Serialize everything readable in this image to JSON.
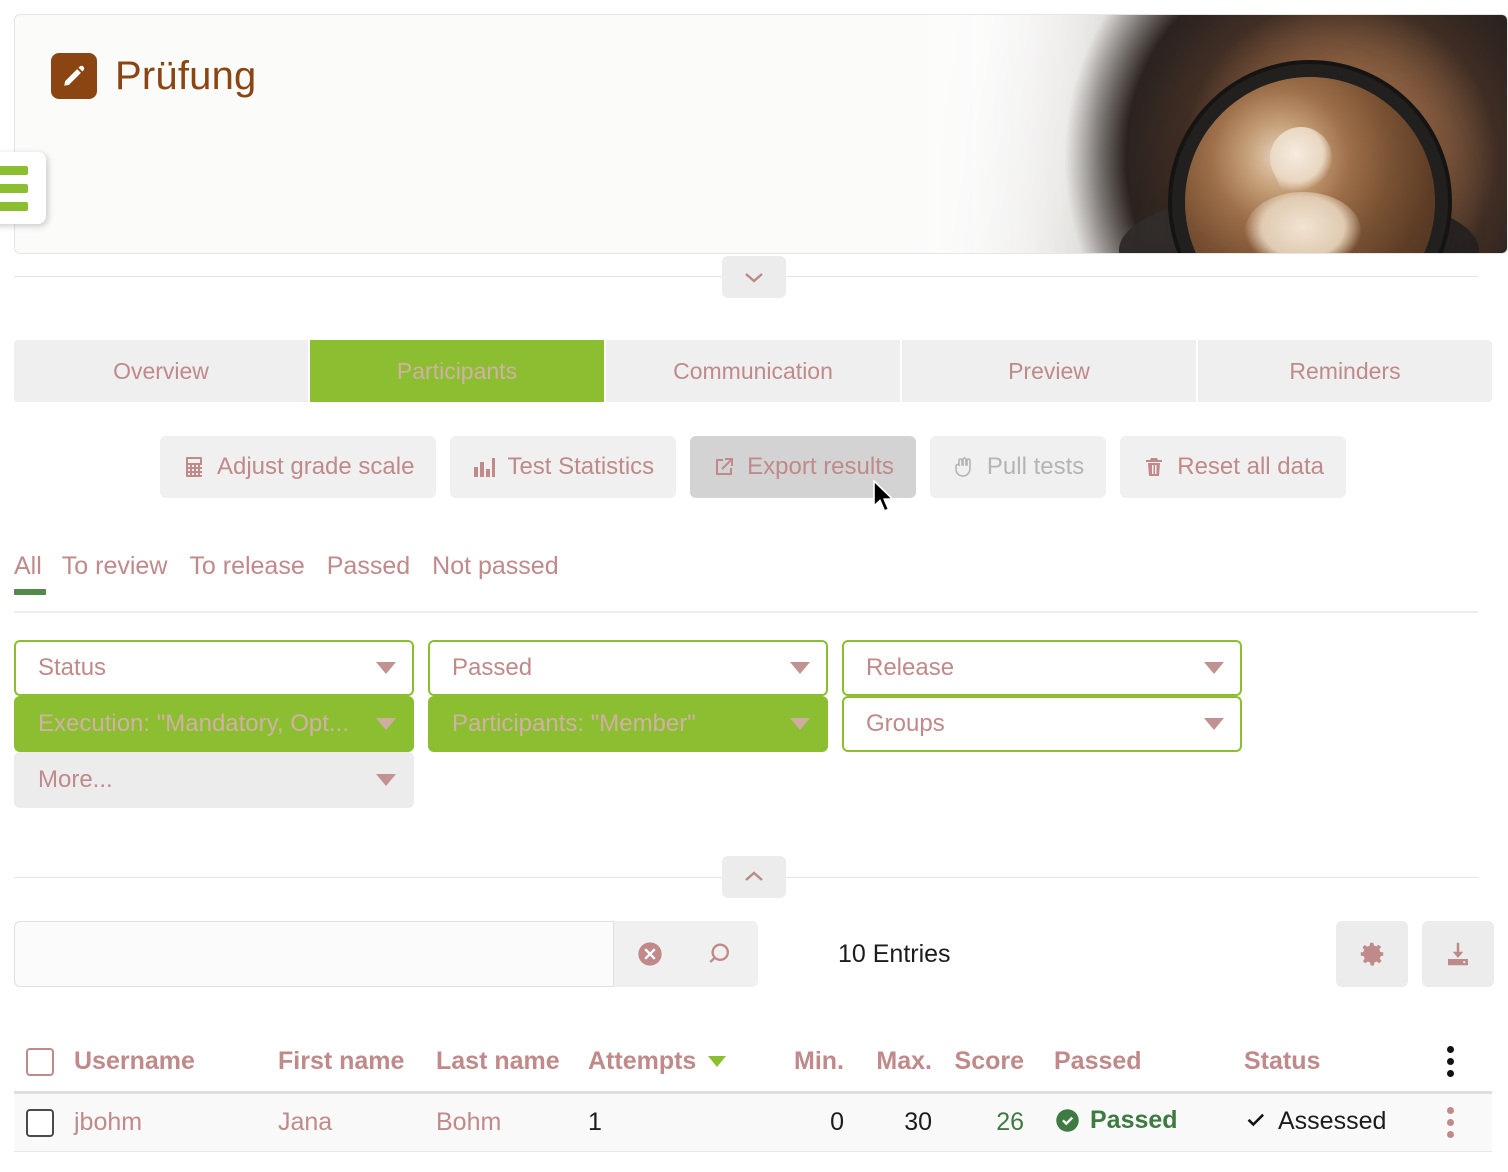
{
  "header": {
    "title": "Prüfung",
    "icon": "pencil-square-icon",
    "menu_icon": "hamburger-menu-icon",
    "banner_image": "coffee-cup-photo",
    "collapse_icon": "chevron-down-icon"
  },
  "tabs": [
    {
      "label": "Overview",
      "active": false
    },
    {
      "label": "Participants",
      "active": true
    },
    {
      "label": "Communication",
      "active": false
    },
    {
      "label": "Preview",
      "active": false
    },
    {
      "label": "Reminders",
      "active": false
    }
  ],
  "toolbar": [
    {
      "label": "Adjust grade scale",
      "icon": "calculator-icon",
      "state": "normal"
    },
    {
      "label": "Test Statistics",
      "icon": "bar-chart-icon",
      "state": "normal"
    },
    {
      "label": "Export results",
      "icon": "share-export-icon",
      "state": "hovered"
    },
    {
      "label": "Pull tests",
      "icon": "hand-icon",
      "state": "disabled"
    },
    {
      "label": "Reset all data",
      "icon": "trash-icon",
      "state": "normal"
    }
  ],
  "subtabs": [
    {
      "label": "All",
      "active": true
    },
    {
      "label": "To review",
      "active": false
    },
    {
      "label": "To release",
      "active": false
    },
    {
      "label": "Passed",
      "active": false
    },
    {
      "label": "Not passed",
      "active": false
    }
  ],
  "filters": [
    {
      "label": "Status",
      "style": "outline",
      "icon": "chevron-down-icon"
    },
    {
      "label": "Passed",
      "style": "outline",
      "icon": "chevron-down-icon"
    },
    {
      "label": "Release",
      "style": "outline",
      "icon": "chevron-down-icon"
    },
    {
      "label": "Execution: \"Mandatory, Opt...",
      "style": "filled",
      "icon": "chevron-down-icon"
    },
    {
      "label": "Participants: \"Member\"",
      "style": "filled",
      "icon": "chevron-down-icon"
    },
    {
      "label": "Groups",
      "style": "outline",
      "icon": "chevron-down-icon"
    },
    {
      "label": "More...",
      "style": "plain",
      "icon": "chevron-down-icon"
    }
  ],
  "search": {
    "value": "",
    "placeholder": "",
    "clear_icon": "clear-circle-icon",
    "search_icon": "magnifier-icon",
    "entries_label": "10 Entries",
    "settings_icon": "gear-icon",
    "download_icon": "download-icon",
    "collapse_icon": "chevron-up-icon"
  },
  "table": {
    "columns": [
      "Username",
      "First name",
      "Last name",
      "Attempts",
      "Min.",
      "Max.",
      "Score",
      "Passed",
      "Status"
    ],
    "sorted_column": "Attempts",
    "sort_icon": "sort-descending-caret",
    "row_menu_icon": "kebab-menu-icon",
    "rows": [
      {
        "username": "jbohm",
        "first_name": "Jana",
        "last_name": "Bohm",
        "attempts": "1",
        "min": "0",
        "max": "30",
        "score": "26",
        "passed": "Passed",
        "passed_icon": "check-circle-icon",
        "status": "Assessed",
        "status_icon": "check-icon"
      }
    ]
  },
  "colors": {
    "accent_green": "#8CBE31",
    "brand_brown": "#8B4513",
    "rose_text": "#c08a8a",
    "success_green": "#3f7a43",
    "underline_green": "#55874f"
  }
}
